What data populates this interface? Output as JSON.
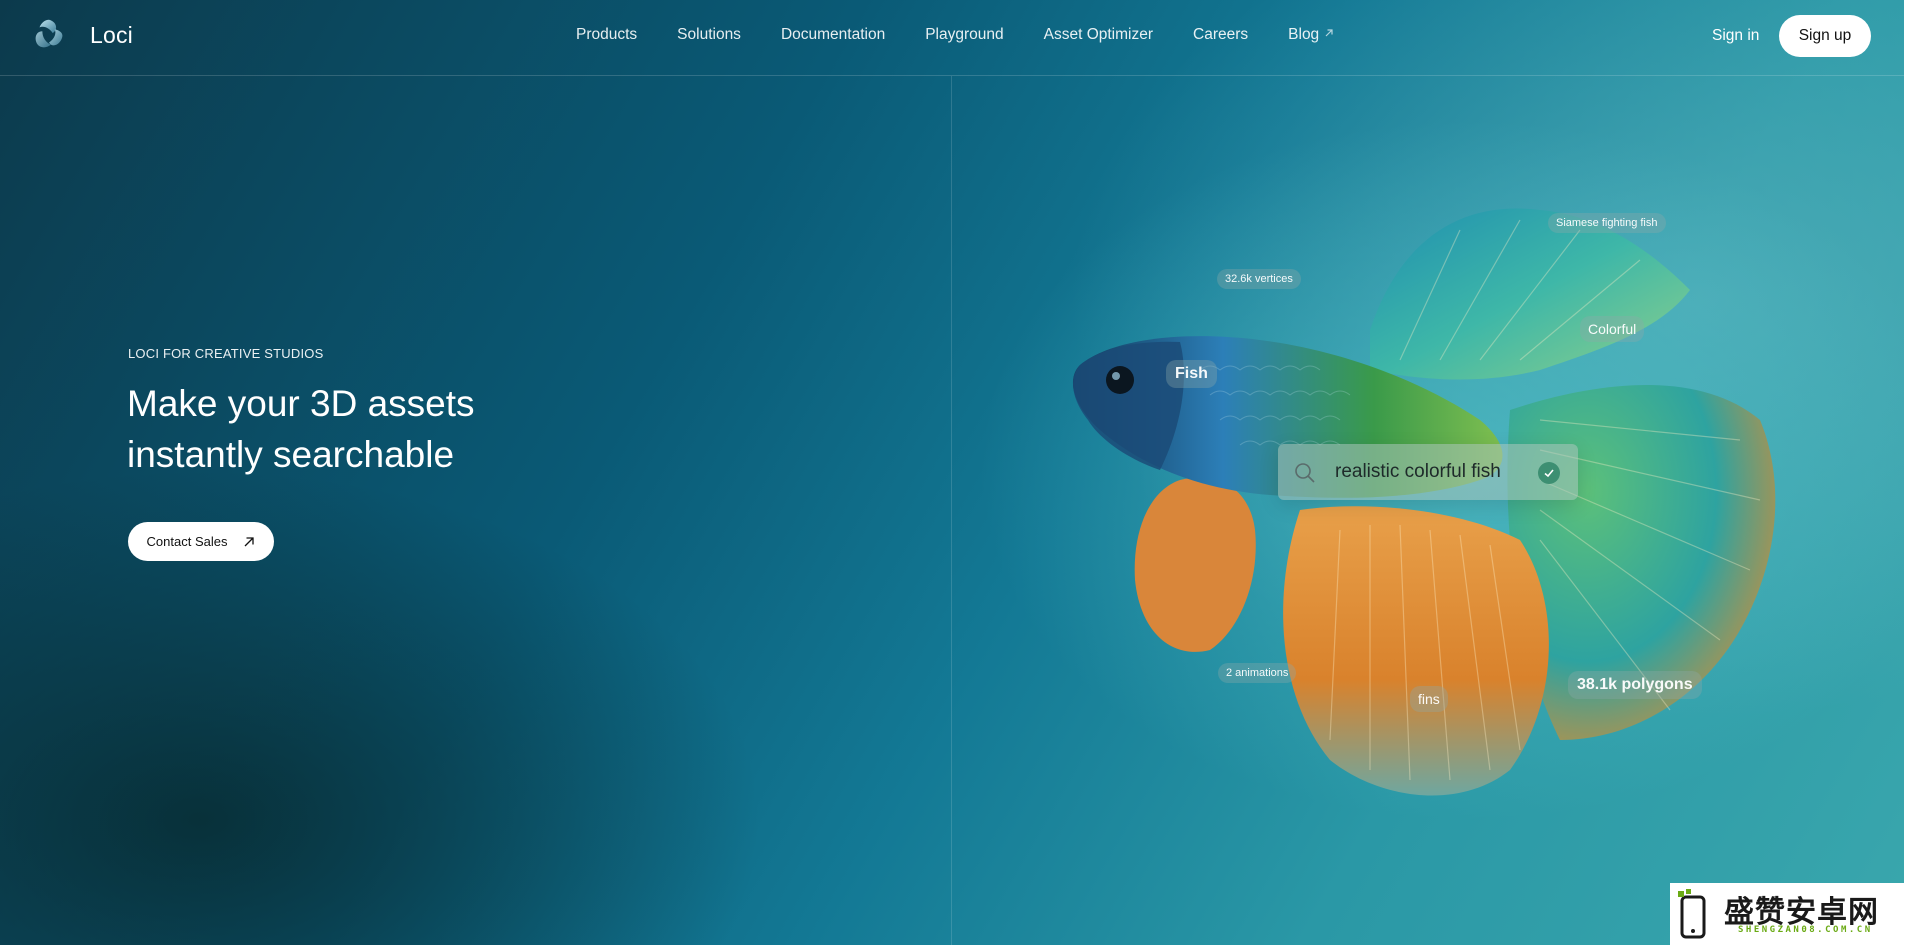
{
  "brand": {
    "name": "Loci"
  },
  "nav": {
    "items": [
      {
        "label": "Products"
      },
      {
        "label": "Solutions"
      },
      {
        "label": "Documentation"
      },
      {
        "label": "Playground"
      },
      {
        "label": "Asset Optimizer"
      },
      {
        "label": "Careers"
      },
      {
        "label": "Blog",
        "external_icon": "arrow-up-right-icon"
      }
    ],
    "sign_in": "Sign in",
    "sign_up": "Sign up"
  },
  "hero": {
    "eyebrow": "LOCI FOR CREATIVE STUDIOS",
    "headline_line1": "Make your 3D assets",
    "headline_line2": "instantly searchable",
    "cta_label": "Contact Sales",
    "cta_icon": "arrow-up-right-icon"
  },
  "illustration": {
    "subject": "betta-fish",
    "tags": {
      "siamese": "Siamese fighting fish",
      "vertices": "32.6k vertices",
      "colorful": "Colorful",
      "fish": "Fish",
      "animations": "2 animations",
      "fins": "fins",
      "polygons": "38.1k polygons"
    },
    "search": {
      "icon": "search-icon",
      "query": "realistic colorful fish",
      "status_icon": "check-icon"
    }
  },
  "watermark": {
    "text_cn": "盛赞安卓网",
    "text_en": "SHENGZAN08.COM.CN"
  },
  "colors": {
    "background_deep": "#0a5a76",
    "background_light": "#3aa7ad",
    "button_bg": "#ffffff",
    "check_green": "#3d8f72"
  }
}
